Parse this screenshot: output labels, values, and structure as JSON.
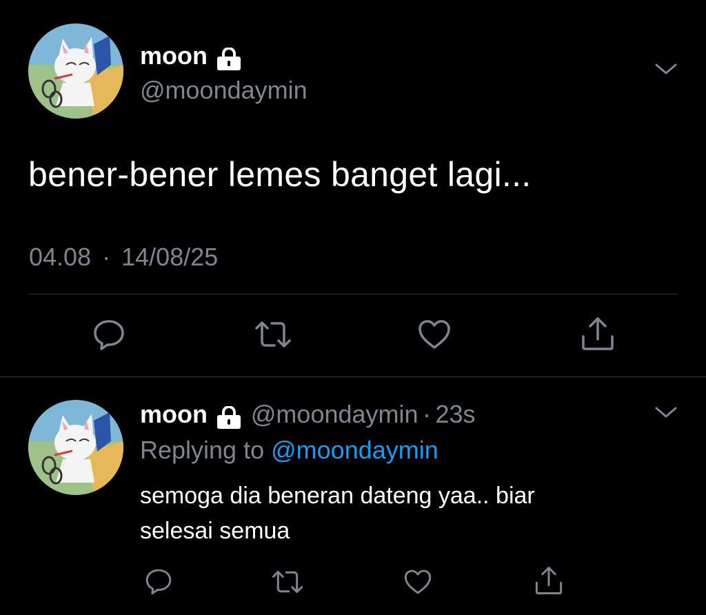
{
  "main_tweet": {
    "display_name": "moon",
    "handle": "@moondaymin",
    "text": "bener-bener lemes banget lagi...",
    "time": "04.08",
    "separator": "·",
    "date": "14/08/25"
  },
  "actions": [
    "reply-icon",
    "retweet-icon",
    "like-icon",
    "share-icon"
  ],
  "reply_tweet": {
    "display_name": "moon",
    "handle": "@moondaymin",
    "separator": "·",
    "age": "23s",
    "replying_prefix": "Replying to",
    "replying_to": "@moondaymin",
    "text_line1": "semoga dia beneran dateng yaa.. biar",
    "text_line2": "selesai semua"
  },
  "colors": {
    "background": "#000000",
    "secondary_text": "#7e8790",
    "link": "#1d9bf0",
    "divider": "#2f3336"
  }
}
